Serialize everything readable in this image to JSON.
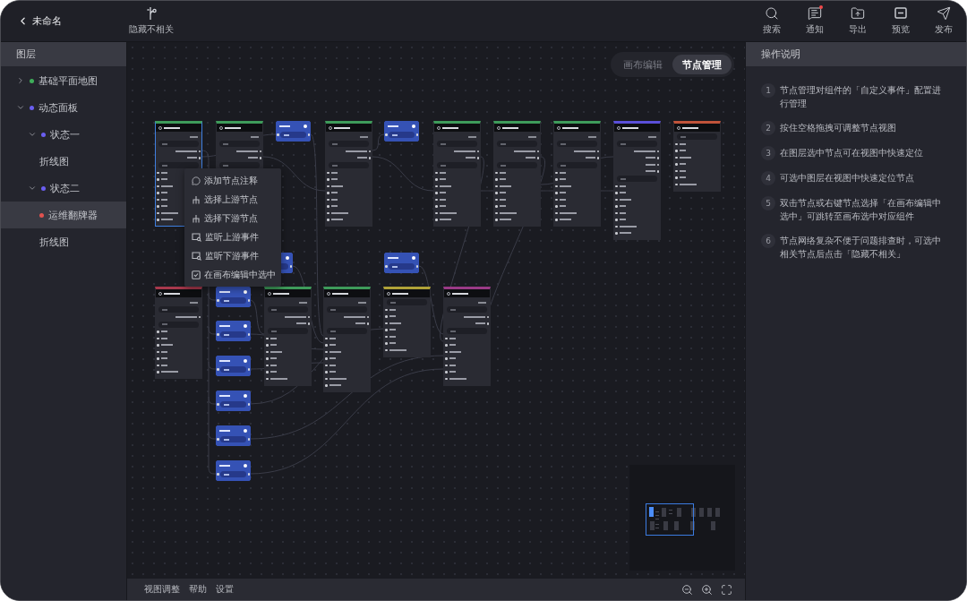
{
  "header": {
    "back": {
      "label": "未命名"
    },
    "hide_unrelated": {
      "label": "隐藏不相关"
    },
    "tools": [
      {
        "kind": "search",
        "label": "搜索",
        "unread": false
      },
      {
        "kind": "notify",
        "label": "通知",
        "unread": true
      },
      {
        "kind": "export",
        "label": "导出",
        "unread": false
      },
      {
        "kind": "preview",
        "label": "预览",
        "unread": false
      },
      {
        "kind": "publish",
        "label": "发布",
        "unread": false
      }
    ]
  },
  "layers": {
    "title": "图层",
    "items": [
      {
        "label": "基础平面地图",
        "color": "#3fae5a",
        "expanded": false,
        "selected": false
      },
      {
        "label": "动态面板",
        "color": "#6a5ef0",
        "expanded": true,
        "selected": false,
        "children": [
          {
            "label": "状态一",
            "color": "#6a5ef0",
            "expanded": true,
            "selected": false,
            "children": [
              {
                "label": "折线图",
                "selected": false
              }
            ]
          },
          {
            "label": "状态二",
            "color": "#6a5ef0",
            "expanded": true,
            "selected": false,
            "children": [
              {
                "label": "运维翻牌器",
                "color": "#e0524f",
                "selected": true
              },
              {
                "label": "折线图",
                "selected": false
              }
            ]
          }
        ]
      }
    ]
  },
  "canvas": {
    "mode_tabs": [
      {
        "label": "画布编辑",
        "selected": false
      },
      {
        "label": "节点管理",
        "selected": true
      }
    ],
    "nodes": [
      {
        "kind": "interaction",
        "color": "#3e9b5a",
        "selected": true
      },
      {
        "kind": "interaction",
        "color": "#3e9b5a",
        "selected": false
      },
      {
        "kind": "event",
        "selected": false
      },
      {
        "kind": "interaction",
        "color": "#3e9b5a",
        "selected": false
      },
      {
        "kind": "event",
        "selected": false
      },
      {
        "kind": "interaction",
        "color": "#3e9b5a",
        "selected": false
      },
      {
        "kind": "interaction",
        "color": "#3e9b5a",
        "selected": false
      },
      {
        "kind": "interaction",
        "color": "#3e9b5a",
        "selected": false
      },
      {
        "kind": "auxiliary",
        "color": "#5a4fd8",
        "selected": false
      },
      {
        "kind": "panel",
        "color": "#c0533a",
        "selected": false
      },
      {
        "kind": "event",
        "selected": false
      },
      {
        "kind": "event",
        "selected": false
      },
      {
        "kind": "single",
        "color": "#a8384c",
        "selected": false
      },
      {
        "kind": "event",
        "selected": false
      },
      {
        "kind": "basic",
        "color": "#3e9b5a",
        "selected": false
      },
      {
        "kind": "interaction",
        "color": "#3e9b5a",
        "selected": false
      },
      {
        "kind": "panel",
        "color": "#b0a238",
        "selected": false
      },
      {
        "kind": "basic",
        "color": "#9a3a86",
        "selected": false
      },
      {
        "kind": "event",
        "selected": false
      },
      {
        "kind": "event",
        "selected": false
      },
      {
        "kind": "event",
        "selected": false
      },
      {
        "kind": "event",
        "selected": false
      },
      {
        "kind": "event",
        "selected": false
      }
    ],
    "context_menu": [
      {
        "kind": "comment",
        "label": "添加节点注释"
      },
      {
        "kind": "tree",
        "label": "选择上游节点"
      },
      {
        "kind": "tree",
        "label": "选择下游节点"
      },
      {
        "kind": "monitor",
        "label": "监听上游事件"
      },
      {
        "kind": "monitor",
        "label": "监听下游事件"
      },
      {
        "kind": "check",
        "label": "在画布编辑中选中"
      }
    ]
  },
  "bottom_bar": {
    "menu": [
      {
        "label": "视图调整"
      },
      {
        "label": "帮助"
      },
      {
        "label": "设置"
      }
    ]
  },
  "guide": {
    "title": "操作说明",
    "steps": [
      {
        "number": "1",
        "text": "节点管理对组件的「自定义事件」配置进行管理"
      },
      {
        "number": "2",
        "text": "按住空格拖拽可调整节点视图"
      },
      {
        "number": "3",
        "text": "在图层选中节点可在视图中快速定位"
      },
      {
        "number": "4",
        "text": "可选中图层在视图中快速定位节点"
      },
      {
        "number": "5",
        "text": "双击节点或右键节点选择「在画布编辑中选中」可跳转至画布选中对应组件"
      },
      {
        "number": "6",
        "text": "节点网络复杂不便于问题排查时，可选中相关节点后点击「隐藏不相关」"
      }
    ]
  }
}
